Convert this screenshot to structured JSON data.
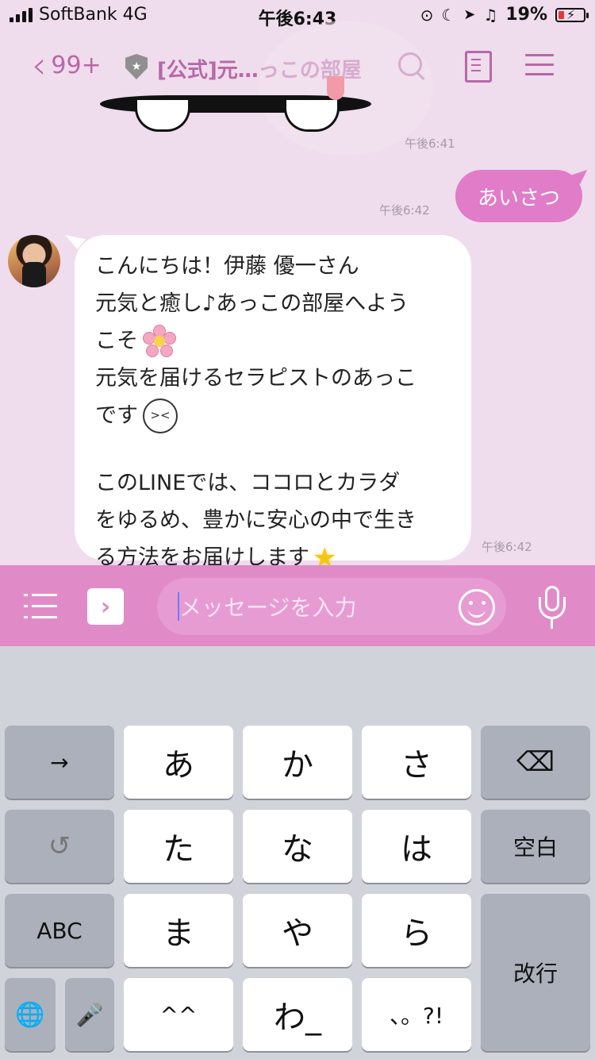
{
  "status": {
    "carrier": "SoftBank 4G",
    "time": "午後6:43",
    "battery": "19%"
  },
  "header": {
    "back_count": "99+",
    "title": "[公式]元…っこの部屋",
    "accent_color": "#b768a8"
  },
  "messages": [
    {
      "type": "sticker",
      "time": "午後6:41"
    },
    {
      "type": "sent",
      "text": "あいさつ",
      "time": "午後6:42"
    },
    {
      "type": "received",
      "time": "午後6:42",
      "lines": [
        "こんにちは！伊藤 優一さん",
        "元気と癒し♪あっこの部屋へよう",
        "こそ",
        "元気を届けるセラピストのあっこ",
        "です",
        "このLINEでは、ココロとカラダ",
        "をゆるめ、豊かに安心の中で生き",
        "る方法をお届けします"
      ],
      "emoji_face": "><"
    }
  ],
  "input": {
    "placeholder": "メッセージを入力",
    "bar_color": "#e08bc8"
  },
  "keyboard": {
    "row1": [
      "→",
      "あ",
      "か",
      "さ",
      "⌫"
    ],
    "row2": [
      "↺",
      "た",
      "な",
      "は",
      "空白"
    ],
    "row3": [
      "ABC",
      "ま",
      "や",
      "ら",
      "改行"
    ],
    "row4": [
      "🌐",
      "🎤",
      "^^",
      "わ_",
      "、。?!"
    ]
  }
}
